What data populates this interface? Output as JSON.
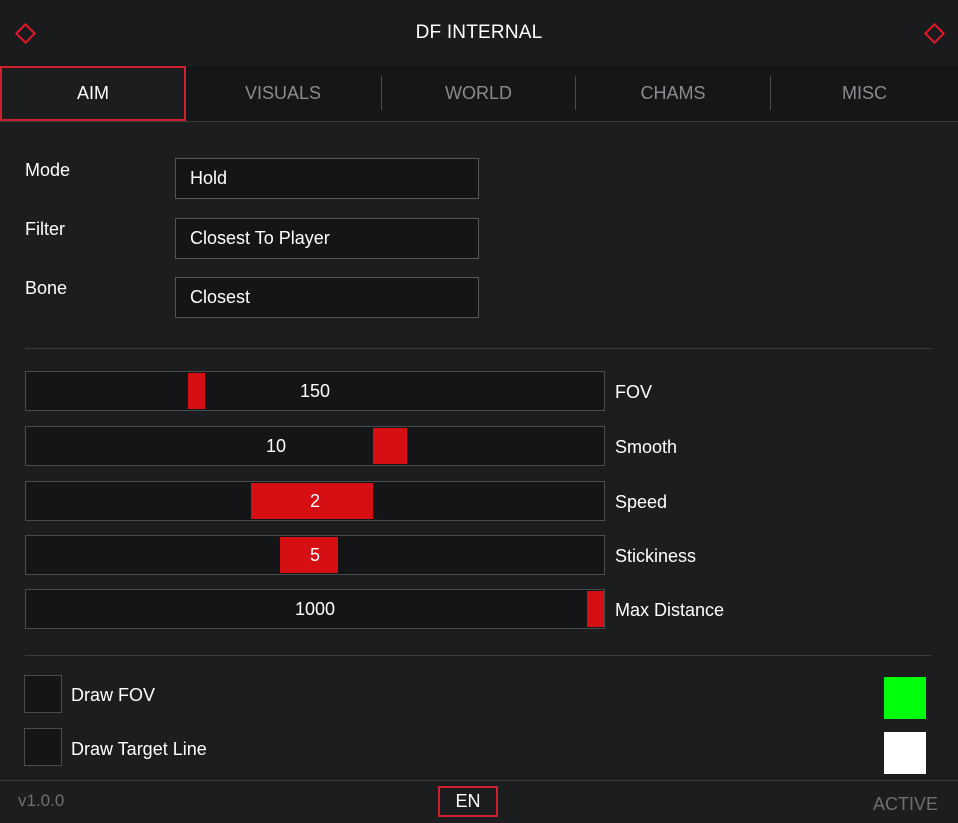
{
  "window": {
    "title": "DF INTERNAL"
  },
  "tabs": [
    {
      "label": "AIM"
    },
    {
      "label": "VISUALS"
    },
    {
      "label": "WORLD"
    },
    {
      "label": "CHAMS"
    },
    {
      "label": "MISC"
    }
  ],
  "active_tab": "AIM",
  "fields": [
    {
      "label": "Mode",
      "value": "Hold"
    },
    {
      "label": "Filter",
      "value": "Closest To Player"
    },
    {
      "label": "Bone",
      "value": "Closest"
    }
  ],
  "sliders": [
    {
      "label": "FOV",
      "value": "150",
      "fill_start_fraction": 0.28,
      "fill_end_fraction": 0.31
    },
    {
      "label": "Smooth",
      "value": "10",
      "fill_start_fraction": 0.6,
      "fill_end_fraction": 0.66
    },
    {
      "label": "Speed",
      "value": "2",
      "fill_start_fraction": 0.39,
      "fill_end_fraction": 0.6
    },
    {
      "label": "Stickiness",
      "value": "5",
      "fill_start_fraction": 0.44,
      "fill_end_fraction": 0.54
    },
    {
      "label": "Max Distance",
      "value": "1000",
      "fill_start_fraction": 0.97,
      "fill_end_fraction": 1.0
    }
  ],
  "checkboxes": [
    {
      "label": "Draw FOV",
      "checked": false,
      "color": "#00ff0a"
    },
    {
      "label": "Draw Target Line",
      "checked": false,
      "color": "#ffffff"
    }
  ],
  "footer": {
    "version": "v1.0.0",
    "language": "EN",
    "status": "ACTIVE"
  },
  "colors": {
    "accent": "#d60f14",
    "background": "#1c1d1f"
  }
}
